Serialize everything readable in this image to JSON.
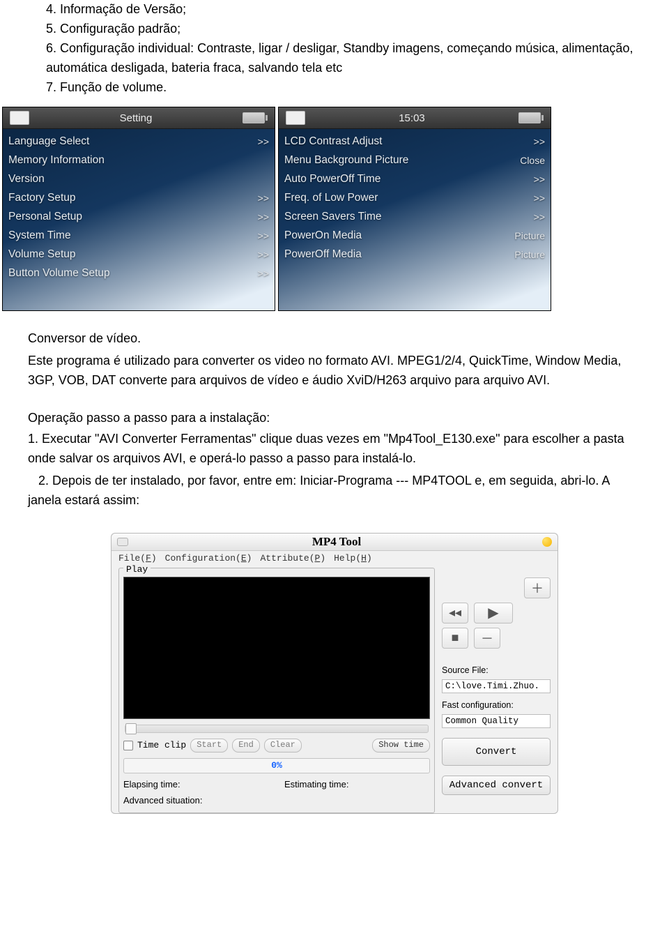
{
  "intro": {
    "l4": "4. Informação de Versão;",
    "l5": "5. Configuração padrão;",
    "l6": "6. Configuração individual: Contraste, ligar / desligar, Standby imagens, começando música, alimentação, automática desligada, bateria fraca, salvando tela etc",
    "l7": "7. Função de volume."
  },
  "shot1": {
    "title": "Setting",
    "items": [
      {
        "label": "Language Select",
        "val": ">>"
      },
      {
        "label": "Memory Information",
        "val": ""
      },
      {
        "label": "Version",
        "val": ""
      },
      {
        "label": "Factory Setup",
        "val": ">>"
      },
      {
        "label": "Personal Setup",
        "val": ">>"
      },
      {
        "label": "System Time",
        "val": ">>"
      },
      {
        "label": "Volume Setup",
        "val": ">>"
      },
      {
        "label": "Button Volume Setup",
        "val": ">>"
      }
    ]
  },
  "shot2": {
    "title": "15:03",
    "items": [
      {
        "label": "LCD Contrast Adjust",
        "val": ">>"
      },
      {
        "label": "Menu Background Picture",
        "val": "Close"
      },
      {
        "label": "Auto PowerOff Time",
        "val": ">>"
      },
      {
        "label": "Freq. of Low Power",
        "val": ">>"
      },
      {
        "label": "Screen Savers Time",
        "val": ">>"
      },
      {
        "label": "PowerOn Media",
        "val": "Picture"
      },
      {
        "label": "PowerOff Media",
        "val": "Picture"
      }
    ]
  },
  "body": {
    "p1a": "Conversor de vídeo.",
    "p1b": "Este programa é utilizado para converter os video no formato AVI. MPEG1/2/4, QuickTime, Window Media, 3GP, VOB, DAT converte para arquivos de vídeo e áudio XviD/H263 arquivo para arquivo AVI.",
    "h2": "Operação passo a passo para a instalação:",
    "p2a": "1. Executar \"AVI Converter Ferramentas\" clique duas vezes em \"Mp4Tool_E130.exe\" para escolher a pasta onde salvar os arquivos AVI, e operá-lo passo a passo para instalá-lo.",
    "p2b": "   2. Depois de ter instalado, por favor, entre em: Iniciar-Programa --- MP4TOOL e, em seguida, abri-lo. A janela estará assim:"
  },
  "mp4": {
    "title": "MP4 Tool",
    "menu": {
      "file": "File(F)",
      "conf": "Configuration(E)",
      "attr": "Attribute(P)",
      "help": "Help(H)"
    },
    "play_leg": "Play",
    "timeclip": "Time clip",
    "btn_start": "Start",
    "btn_end": "End",
    "btn_clear": "Clear",
    "btn_show": "Show time",
    "progress": "0%",
    "elapsing": "Elapsing time:",
    "estimating": "Estimating time:",
    "adv": "Advanced situation:",
    "srcfile_label": "Source File:",
    "srcfile_value": "C:\\love.Timi.Zhuo.",
    "fastconf_label": "Fast configuration:",
    "fastconf_value": "Common Quality",
    "convert": "Convert",
    "advconvert": "Advanced convert"
  }
}
